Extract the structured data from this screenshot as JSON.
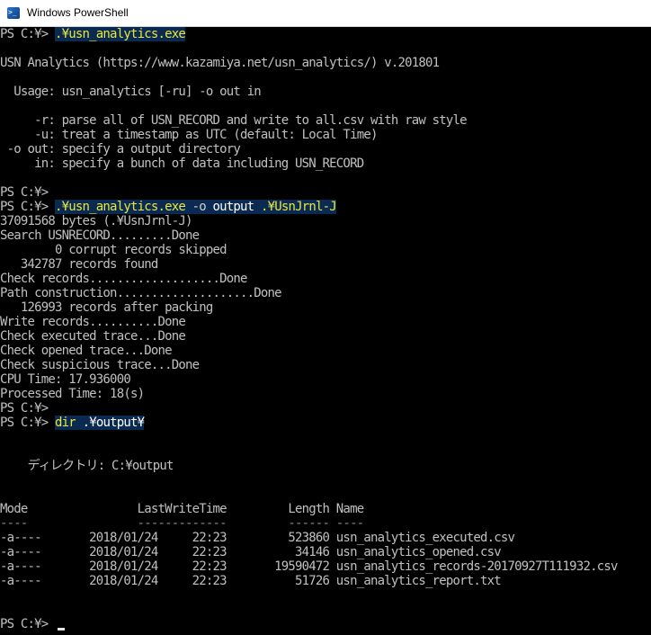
{
  "window": {
    "title": "Windows PowerShell"
  },
  "cmd1": {
    "prompt": "PS C:¥> ",
    "command": ".¥usn_analytics.exe"
  },
  "help": {
    "header": "USN Analytics (https://www.kazamiya.net/usn_analytics/) v.201801",
    "usage": "  Usage: usn_analytics [-ru] -o out in",
    "opt_r": "     -r: parse all of USN_RECORD and write to all.csv with raw style",
    "opt_u": "     -u: treat a timestamp as UTC (default: Local Time)",
    "opt_o": " -o out: specify a output directory",
    "opt_in": "     in: specify a bunch of data including USN_RECORD"
  },
  "prompt_blank_1": "PS C:¥>",
  "cmd2": {
    "prompt": "PS C:¥> ",
    "exe": ".¥usn_analytics.exe",
    "flag": "-o",
    "output_dir": "output",
    "input": ".¥UsnJrnl-J"
  },
  "run_output": [
    "37091568 bytes (.¥UsnJrnl-J)",
    "Search USNRECORD.........Done",
    "        0 corrupt records skipped",
    "   342787 records found",
    "Check records...................Done",
    "Path construction....................Done",
    "   126993 records after packing",
    "Write records..........Done",
    "Check executed trace...Done",
    "Check opened trace...Done",
    "Check suspicious trace...Done",
    "CPU Time: 17.936000",
    "Processed Time: 18(s)"
  ],
  "prompt_blank_2": "PS C:¥>",
  "cmd3": {
    "prompt": "PS C:¥> ",
    "command": "dir",
    "arg": ".¥output¥"
  },
  "dir": {
    "directory_line": "    ディレクトリ: C:¥output",
    "header_line": "Mode                LastWriteTime         Length Name",
    "separator_line": "----                -------------         ------ ----",
    "rows": [
      "-a----       2018/01/24     22:23         523860 usn_analytics_executed.csv",
      "-a----       2018/01/24     22:23          34146 usn_analytics_opened.csv",
      "-a----       2018/01/24     22:23       19590472 usn_analytics_records-20170927T111932.csv",
      "-a----       2018/01/24     22:23          51726 usn_analytics_report.txt"
    ]
  },
  "final_prompt": "PS C:¥> ",
  "colors": {
    "background": "#000000",
    "text": "#c0c0c0",
    "highlight_bg": "#0a2a52",
    "highlight_text": "#e6e640"
  }
}
